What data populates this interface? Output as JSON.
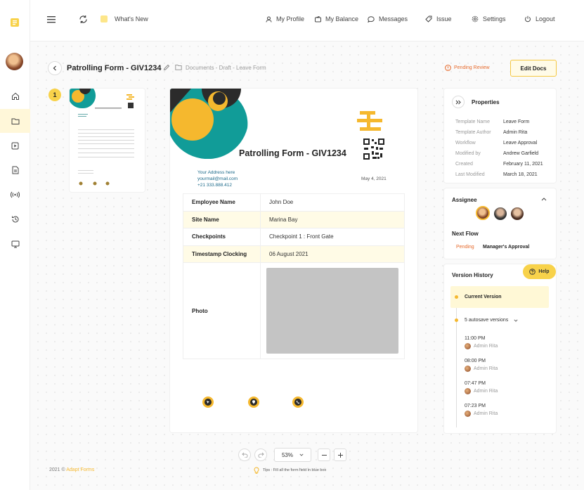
{
  "topnav": {
    "whats_new": "What's New",
    "profile": "My Profile",
    "balance": "My Balance",
    "messages": "Messages",
    "issue": "Issue",
    "settings": "Settings",
    "logout": "Logout"
  },
  "header": {
    "title": "Patrolling Form - GIV1234",
    "breadcrumb": "Documents - Draft - Leave Form",
    "status": "Pending Review",
    "edit_button": "Edit Docs"
  },
  "thumbnail": {
    "page_number": "1"
  },
  "document": {
    "title": "Patrolling Form - GIV1234",
    "address_line1": "Your Address here",
    "address_line2": "yourmail@mail.com",
    "address_line3": "+21 333.888.412",
    "date": "May 4, 2021",
    "rows": [
      {
        "label": "Employee Name",
        "value": "John Doe"
      },
      {
        "label": "Site Name",
        "value": "Marina Bay"
      },
      {
        "label": "Checkpoints",
        "value": "Checkpoint 1 : Front Gate"
      },
      {
        "label": "Timestamp Clocking",
        "value": "06 August 2021"
      },
      {
        "label": "Photo",
        "value": ""
      }
    ]
  },
  "properties": {
    "title": "Properties",
    "items": [
      {
        "key": "Template Name",
        "value": "Leave Form"
      },
      {
        "key": "Template Author",
        "value": "Admin Rita"
      },
      {
        "key": "Workflow",
        "value": "Leave Approval"
      },
      {
        "key": "Modified by",
        "value": "Andrew Garfield"
      },
      {
        "key": "Created",
        "value": "February 11, 2021"
      },
      {
        "key": "Last Modified",
        "value": "March 18, 2021"
      }
    ]
  },
  "assignee": {
    "title": "Assignee",
    "next_flow_title": "Next Flow",
    "flow_status": "Pending",
    "flow_step": "Manager's Approval"
  },
  "version_history": {
    "title": "Version History",
    "help": "Help",
    "current": "Current Version",
    "autosave": "5 autosave versions",
    "versions": [
      {
        "time": "11:00 PM",
        "user": "Admin Rita"
      },
      {
        "time": "08:00 PM",
        "user": "Admin Rita"
      },
      {
        "time": "07:47 PM",
        "user": "Admin Rita"
      },
      {
        "time": "07:23 PM",
        "user": "Admin Rita"
      }
    ]
  },
  "toolbar": {
    "zoom": "53%"
  },
  "footer": {
    "copyright": "2021 ©",
    "brand": "Adapt Forms",
    "tip": "Tips : Fill all the form field in blue box"
  },
  "colors": {
    "accent": "#f5b82e",
    "teal": "#119c98",
    "dark": "#2b2b2b",
    "pending": "#e66a2c"
  }
}
